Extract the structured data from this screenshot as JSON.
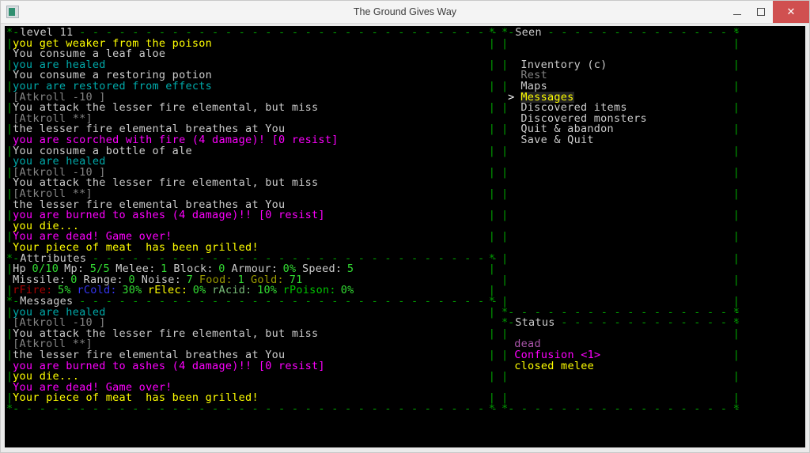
{
  "window": {
    "title": "The Ground Gives Way",
    "app_icon": "app-icon",
    "minimize_label": "–",
    "maximize_label": "□",
    "close_label": "✕"
  },
  "panels": {
    "level": {
      "title": "level 11"
    },
    "attributes": {
      "title": "Attributes"
    },
    "messages": {
      "title": "Messages"
    },
    "seen": {
      "title": "Seen"
    },
    "status": {
      "title": "Status"
    }
  },
  "log_top": {
    "lines": [
      {
        "text": "you get weaker from the poison",
        "color": "c-yellow"
      },
      {
        "text": "You consume a leaf aloe",
        "color": "c-white"
      },
      {
        "text": "you are healed",
        "color": "c-cyan"
      },
      {
        "text": "You consume a restoring potion",
        "color": "c-white"
      },
      {
        "text": "your are restored from effects",
        "color": "c-cyan"
      },
      {
        "text": "[Atkroll -10 ]",
        "color": "c-gray"
      },
      {
        "text": "You attack the lesser fire elemental, but miss",
        "color": "c-white"
      },
      {
        "text": "[Atkroll **]",
        "color": "c-gray"
      },
      {
        "text": "the lesser fire elemental breathes at You",
        "color": "c-white"
      },
      {
        "text": "you are scorched with fire (4 damage)! [0 resist]",
        "color": "c-magenta"
      },
      {
        "text": "You consume a bottle of ale",
        "color": "c-white"
      },
      {
        "text": "you are healed",
        "color": "c-cyan"
      },
      {
        "text": "[Atkroll -10 ]",
        "color": "c-gray"
      },
      {
        "text": "You attack the lesser fire elemental, but miss",
        "color": "c-white"
      },
      {
        "text": "[Atkroll **]",
        "color": "c-gray"
      },
      {
        "text": "the lesser fire elemental breathes at You",
        "color": "c-white"
      },
      {
        "text": "you are burned to ashes (4 damage)!! [0 resist]",
        "color": "c-magenta"
      },
      {
        "text": "you die...",
        "color": "c-yellow"
      },
      {
        "text": "You are dead! Game over!",
        "color": "c-magenta"
      },
      {
        "text": "Your piece of meat  has been grilled!",
        "color": "c-yellow"
      }
    ]
  },
  "attributes": {
    "row1": [
      {
        "label": "Hp",
        "value": "0/10"
      },
      {
        "label": "Mp:",
        "value": "5/5"
      },
      {
        "label": "Melee:",
        "value": "1"
      },
      {
        "label": "Block:",
        "value": "0"
      },
      {
        "label": "Armour:",
        "value": "0%"
      },
      {
        "label": "Speed:",
        "value": "5"
      }
    ],
    "row2": [
      {
        "label": "Missile:",
        "value": "0",
        "label_color": "c-white"
      },
      {
        "label": "Range:",
        "value": "0",
        "label_color": "c-white"
      },
      {
        "label": "Noise:",
        "value": "7",
        "label_color": "c-white"
      },
      {
        "label": "Food:",
        "value": "1",
        "label_color": "c-dkyellow"
      },
      {
        "label": "Gold:",
        "value": "71",
        "label_color": "c-dkyellow"
      }
    ],
    "row3": [
      {
        "label": "rFire:",
        "value": "5%",
        "label_color": "c-red"
      },
      {
        "label": "rCold:",
        "value": "30%",
        "label_color": "c-blue"
      },
      {
        "label": "rElec:",
        "value": "0%",
        "label_color": "c-yellow"
      },
      {
        "label": "rAcid:",
        "value": "10%",
        "label_color": "c-paleg"
      },
      {
        "label": "rPoison:",
        "value": "0%",
        "label_color": "c-green"
      }
    ]
  },
  "log_bottom": {
    "lines": [
      {
        "text": "you are healed",
        "color": "c-cyan"
      },
      {
        "text": "[Atkroll -10 ]",
        "color": "c-gray"
      },
      {
        "text": "You attack the lesser fire elemental, but miss",
        "color": "c-white"
      },
      {
        "text": "[Atkroll **]",
        "color": "c-gray"
      },
      {
        "text": "the lesser fire elemental breathes at You",
        "color": "c-white"
      },
      {
        "text": "you are burned to ashes (4 damage)!! [0 resist]",
        "color": "c-magenta"
      },
      {
        "text": "you die...",
        "color": "c-yellow"
      },
      {
        "text": "You are dead! Game over!",
        "color": "c-magenta"
      },
      {
        "text": "Your piece of meat  has been grilled!",
        "color": "c-yellow"
      }
    ]
  },
  "menu": {
    "cursor": ">",
    "items": [
      {
        "label": "Inventory (c)",
        "state": "normal"
      },
      {
        "label": "Rest",
        "state": "disabled"
      },
      {
        "label": "Maps",
        "state": "normal"
      },
      {
        "label": "Messages",
        "state": "selected"
      },
      {
        "label": "Discovered items",
        "state": "normal"
      },
      {
        "label": "Discovered monsters",
        "state": "normal"
      },
      {
        "label": "Quit & abandon",
        "state": "normal"
      },
      {
        "label": "Save & Quit",
        "state": "normal"
      }
    ]
  },
  "status": {
    "effects": [
      {
        "text": "dead",
        "color": "c-dkmagenta"
      },
      {
        "text": "Confusion <1>",
        "color": "c-magenta"
      },
      {
        "text": "closed melee",
        "color": "c-yellow"
      }
    ]
  },
  "theme": {
    "border": "#00a000",
    "background": "#000000",
    "accent_close": "#d05050"
  }
}
